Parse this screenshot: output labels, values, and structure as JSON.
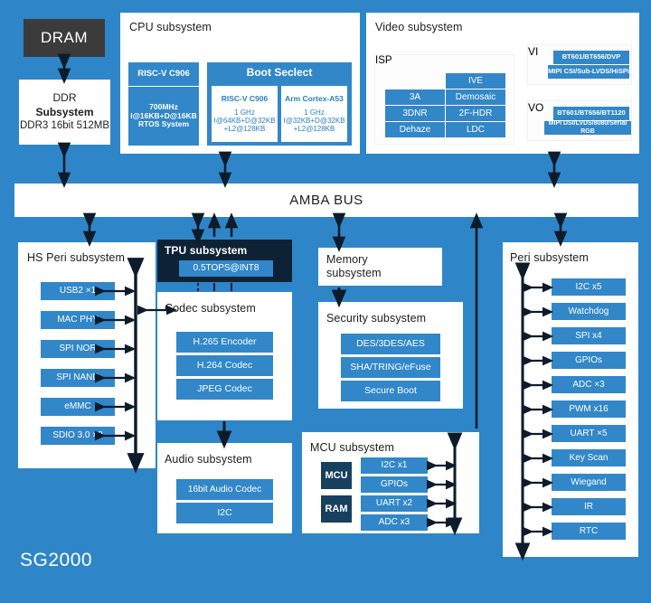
{
  "chip_name": "SG2000",
  "colors": {
    "background": "#2e86c8",
    "panel": "#ffffff",
    "chip_blue": "#3287c9",
    "chip_navy": "#17405f",
    "dark_panel": "#0e2236",
    "dram": "#3b3b3b",
    "arrow": "#0d1b2a"
  },
  "dram": {
    "label": "DRAM"
  },
  "ddr_subsystem": {
    "line1": "DDR",
    "line2": "Subsystem",
    "line3": "DDR3 16bit 512MB"
  },
  "cpu_subsystem": {
    "title": "CPU subsystem",
    "core": {
      "header": "RISC-V C906",
      "specs": [
        "700MHz",
        "I@16KB+D@16KB",
        "RTOS System"
      ]
    },
    "boot_select": {
      "header": "Boot Seclect",
      "options": [
        {
          "name": "RISC-V C906",
          "specs": [
            "1 GHz",
            "I@64KB+D@32KB",
            "+L2@128KB"
          ]
        },
        {
          "name": "Arm Cortex-A53",
          "specs": [
            "1 GHz",
            "I@32KB+D@32KB",
            "+L2@128KB"
          ]
        }
      ]
    }
  },
  "video_subsystem": {
    "title": "Video subsystem",
    "isp": {
      "title": "ISP",
      "left_column": [
        "3A",
        "3DNR",
        "Dehaze"
      ],
      "right_column": [
        "IVE",
        "Demosaic",
        "2F-HDR",
        "LDC"
      ]
    },
    "vi": {
      "label": "VI",
      "items": [
        "BT601/BT656/DVP",
        "MIPI CSI/Sub-LVDS/HiSPi"
      ]
    },
    "vo": {
      "label": "VO",
      "items": [
        "BT601/BT656/BT1120",
        "MIPI DSI/LVDS/8080/Serial RGB"
      ]
    }
  },
  "bus": {
    "label": "AMBA BUS"
  },
  "hs_peri_subsystem": {
    "title": "HS Peri subsystem",
    "items": [
      "USB2 ×1",
      "MAC PHY",
      "SPI NOR",
      "SPI NAND",
      "eMMC",
      "SDIO 3.0 ×2"
    ]
  },
  "tpu_subsystem": {
    "title": "TPU subsystem",
    "spec": "0.5TOPS@INT8"
  },
  "codec_subsystem": {
    "title": "Codec subsystem",
    "items": [
      "H.265 Encoder",
      "H.264 Codec",
      "JPEG Codec"
    ]
  },
  "audio_subsystem": {
    "title": "Audio subsystem",
    "items": [
      "16bit Audio Codec",
      "I2C"
    ]
  },
  "memory_subsystem": {
    "line1": "Memory",
    "line2": "subsystem"
  },
  "security_subsystem": {
    "title": "Security subsystem",
    "items": [
      "DES/3DES/AES",
      "SHA/TRING/eFuse",
      "Secure Boot"
    ]
  },
  "mcu_subsystem": {
    "title": "MCU subsystem",
    "blocks": [
      "MCU",
      "RAM"
    ],
    "items": [
      "I2C x1",
      "GPIOs",
      "UART x2",
      "ADC x3"
    ]
  },
  "peri_subsystem": {
    "title": "Peri subsystem",
    "items": [
      "I2C x5",
      "Watchdog",
      "SPI x4",
      "GPIOs",
      "ADC ×3",
      "PWM x16",
      "UART ×5",
      "Key Scan",
      "Wiegand",
      "IR",
      "RTC"
    ]
  }
}
